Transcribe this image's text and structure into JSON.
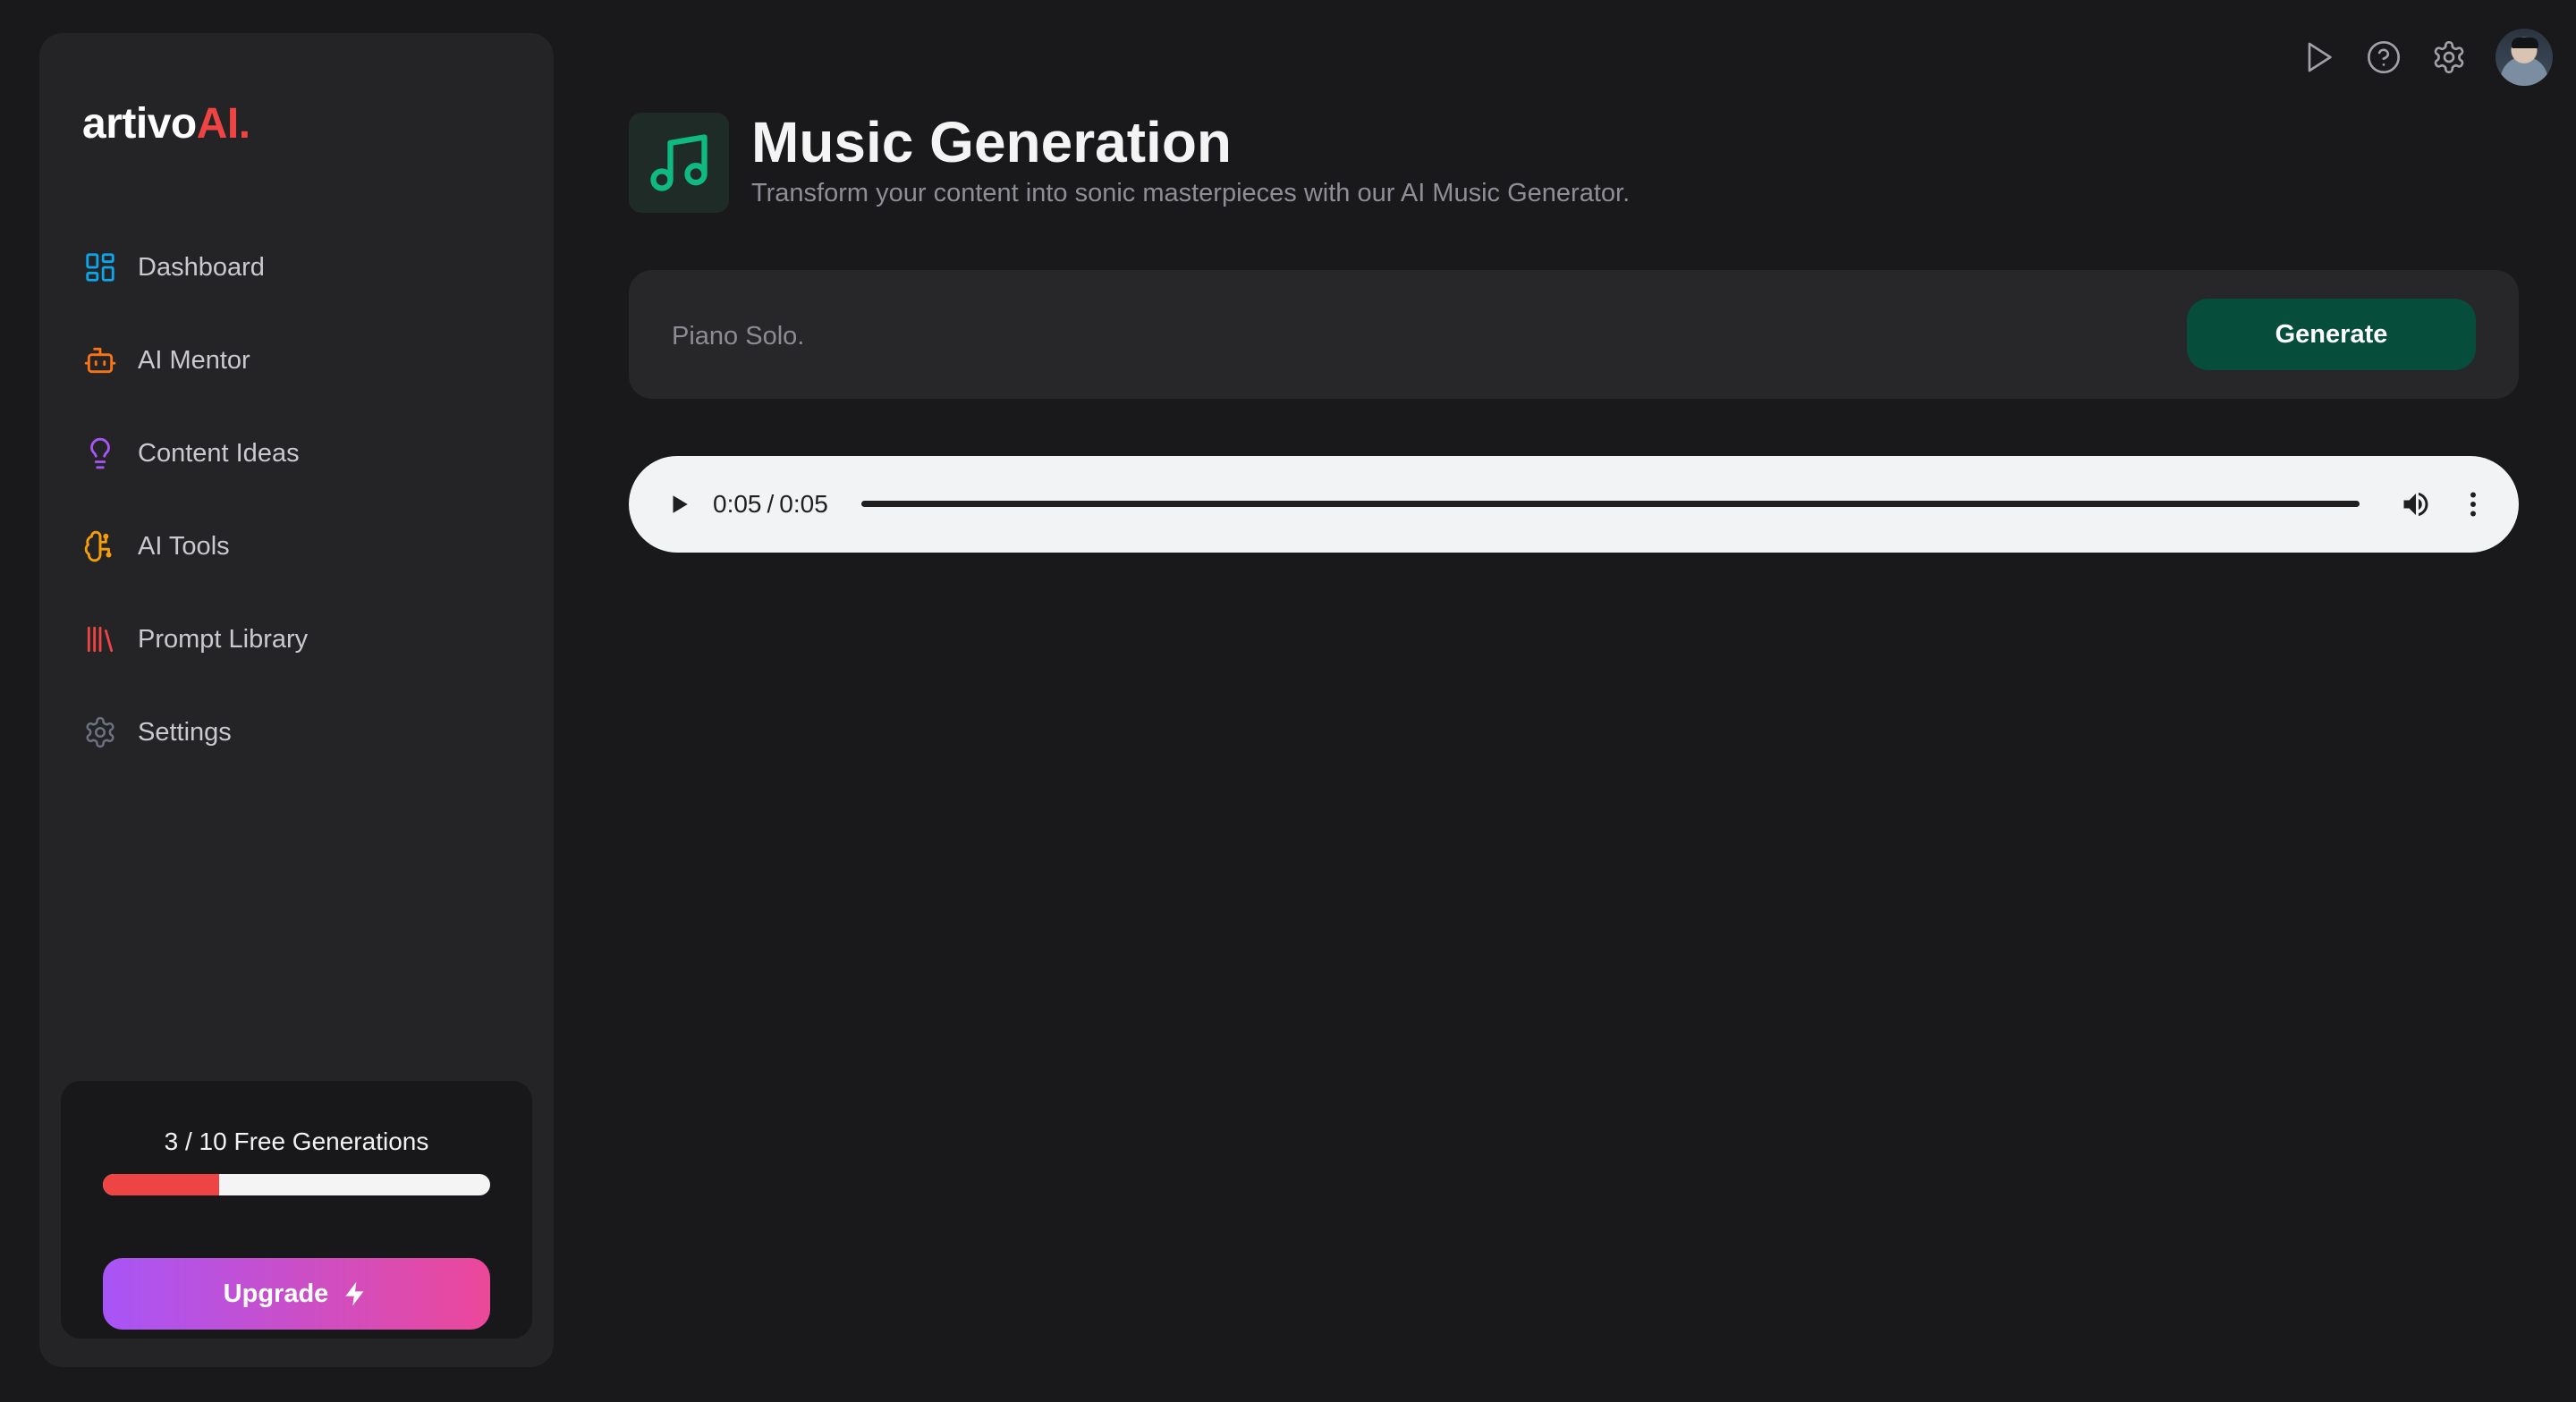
{
  "brand": {
    "name_main": "artivo",
    "name_accent": "AI.",
    "accent_color": "#ef4444"
  },
  "sidebar": {
    "items": [
      {
        "label": "Dashboard",
        "icon": "grid-icon",
        "color": "#0ea5e9"
      },
      {
        "label": "AI Mentor",
        "icon": "robot-icon",
        "color": "#f97316"
      },
      {
        "label": "Content Ideas",
        "icon": "lightbulb-icon",
        "color": "#a855f7"
      },
      {
        "label": "AI Tools",
        "icon": "brain-circuit-icon",
        "color": "#f59e0b"
      },
      {
        "label": "Prompt Library",
        "icon": "library-icon",
        "color": "#ef4444"
      },
      {
        "label": "Settings",
        "icon": "gear-icon",
        "color": "#6b7280"
      }
    ],
    "usage": {
      "text": "3 / 10 Free Generations",
      "used": 3,
      "total": 10,
      "fill_color": "#ef4444"
    },
    "upgrade_label": "Upgrade"
  },
  "topbar": {
    "icons": [
      "play-icon",
      "help-circle-icon",
      "gear-icon",
      "avatar"
    ]
  },
  "header": {
    "title": "Music Generation",
    "subtitle": "Transform your content into sonic masterpieces with our AI Music Generator.",
    "icon": "music-note-icon",
    "icon_color": "#10b981"
  },
  "prompt": {
    "value": "",
    "placeholder": "Piano Solo.",
    "generate_label": "Generate",
    "button_color": "#064e3b"
  },
  "audio": {
    "current_time": "0:05",
    "separator": "/",
    "duration": "0:05",
    "progress": 1.0
  }
}
